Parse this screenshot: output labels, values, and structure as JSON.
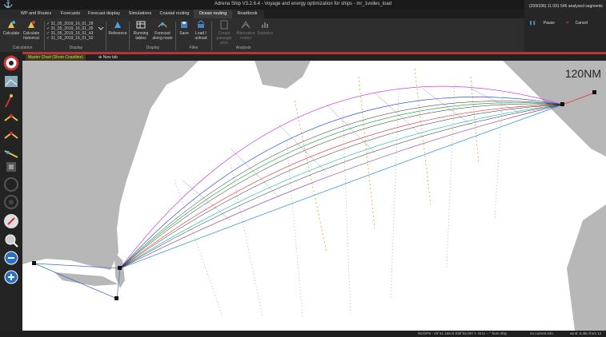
{
  "window": {
    "title": "Adrena Ship V3.2.6.4 - Voyage and energy optimization for ships - mr_1voiles_load"
  },
  "menu": {
    "items": [
      {
        "label": "WP and Routes",
        "active": false
      },
      {
        "label": "Forecasts",
        "active": false
      },
      {
        "label": "Forecast display",
        "active": false
      },
      {
        "label": "Simulations",
        "active": false
      },
      {
        "label": "Coastal routing",
        "active": false
      },
      {
        "label": "Ocean routing",
        "active": true
      },
      {
        "label": "Roadbook",
        "active": false
      }
    ]
  },
  "ribbon": {
    "calculate": "Calculate",
    "calculate_historical": "Calculate historical",
    "group_calculation": "Calculation",
    "files": [
      "31_05_2019_16_01_28",
      "31_05_2019_16_01_35",
      "31_05_2019_16_01_43",
      "31_05_2019_16_01_50"
    ],
    "group_display1": "Display",
    "reference": "Reference",
    "running_tables": "Running tables",
    "forecast_along_route": "Forecast along route",
    "group_display2": "Display",
    "save": "Save",
    "load_unload": "Load / unload",
    "group_files": "Files",
    "create_passage_plan": "Create passage plan",
    "alternative_routes": "Alternative routes",
    "statistics": "Statistics",
    "group_analysis": "Analysis"
  },
  "progress_panel": {
    "status": "(209/336) 11 091 546 analysed segments",
    "pause": "Pause",
    "cancel": "Cancel"
  },
  "tabs": {
    "master": "Master Chart (Shom Coastline)",
    "new": "New tab"
  },
  "map": {
    "scale": "120NM"
  },
  "status": {
    "gps": "NOGPS - 25°41.156 N 038°02.007 I",
    "bearing": "-- M to -- ° from ship",
    "info": "no current info.",
    "wind": "wind: 5.4kn from 12"
  },
  "colors": {
    "accent_red": "#c0392b",
    "tab_yellow": "#d8d850"
  }
}
